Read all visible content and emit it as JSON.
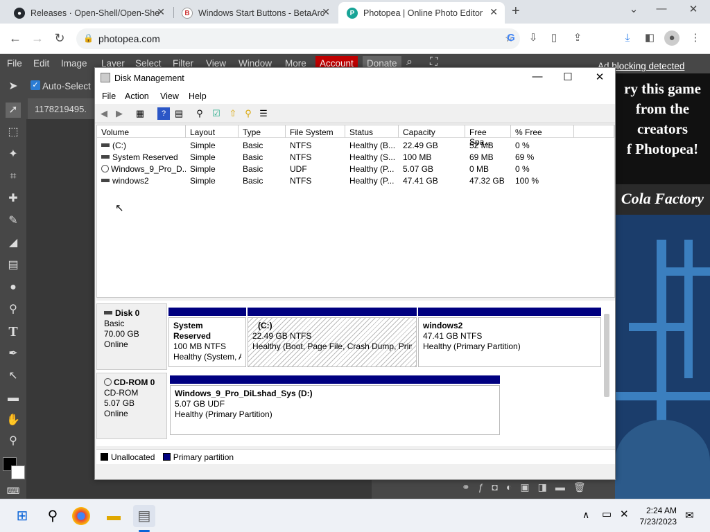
{
  "browser": {
    "tabs": [
      {
        "title": "Releases · Open-Shell/Open-She",
        "favicon": "github-icon"
      },
      {
        "title": "Windows Start Buttons - BetaArc",
        "favicon": "betaarchive-icon"
      },
      {
        "title": "Photopea | Online Photo Editor",
        "favicon": "photopea-icon",
        "active": true
      }
    ],
    "new_tab": "+",
    "url": "photopea.com"
  },
  "photopea": {
    "menu": [
      "File",
      "Edit",
      "Image",
      "Layer",
      "Select",
      "Filter",
      "View",
      "Window",
      "More",
      "Account",
      "Donate"
    ],
    "auto_select": "Auto-Select",
    "doc_tab": "1178219495.",
    "ad_text": [
      "ry this game",
      "from the",
      "creators",
      "f Photopea!"
    ],
    "ad_game": "Cola Factory",
    "adblock": "Ad blocking detected"
  },
  "disk_mgmt": {
    "title": "Disk Management",
    "menu": [
      "File",
      "Action",
      "View",
      "Help"
    ],
    "columns": [
      "Volume",
      "Layout",
      "Type",
      "File System",
      "Status",
      "Capacity",
      "Free Spa...",
      "% Free"
    ],
    "rows": [
      [
        "(C:)",
        "Simple",
        "Basic",
        "NTFS",
        "Healthy (B...",
        "22.49 GB",
        "52 MB",
        "0 %"
      ],
      [
        "System Reserved",
        "Simple",
        "Basic",
        "NTFS",
        "Healthy (S...",
        "100 MB",
        "69 MB",
        "69 %"
      ],
      [
        "Windows_9_Pro_D...",
        "Simple",
        "Basic",
        "UDF",
        "Healthy (P...",
        "5.07 GB",
        "0 MB",
        "0 %"
      ],
      [
        "windows2",
        "Simple",
        "Basic",
        "NTFS",
        "Healthy (P...",
        "47.41 GB",
        "47.32 GB",
        "100 %"
      ]
    ],
    "disk0": {
      "name": "Disk 0",
      "type": "Basic",
      "size": "70.00 GB",
      "state": "Online",
      "parts": [
        {
          "name": "System Reserved",
          "size": "100 MB NTFS",
          "status": "Healthy (System, A"
        },
        {
          "name": "(C:)",
          "size": "22.49 GB NTFS",
          "status": "Healthy (Boot, Page File, Crash Dump, Prim"
        },
        {
          "name": "windows2",
          "size": "47.41 GB NTFS",
          "status": "Healthy (Primary Partition)"
        }
      ]
    },
    "cdrom0": {
      "name": "CD-ROM 0",
      "type": "CD-ROM",
      "size": "5.07 GB",
      "state": "Online",
      "part": {
        "name": "Windows_9_Pro_DiLshad_Sys  (D:)",
        "size": "5.07 GB UDF",
        "status": "Healthy (Primary Partition)"
      }
    },
    "legend": [
      "Unallocated",
      "Primary partition"
    ]
  },
  "taskbar": {
    "time": "2:24 AM",
    "date": "7/23/2023"
  },
  "colors": {
    "primary_partition": "#000080",
    "account": "#c00000"
  }
}
